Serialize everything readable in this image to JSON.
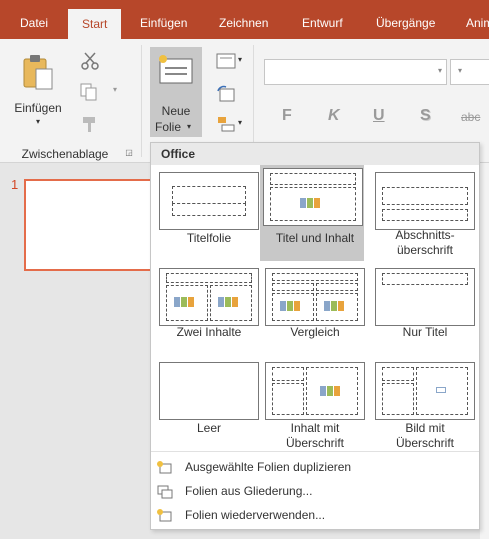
{
  "tabs": [
    {
      "label": "Datei"
    },
    {
      "label": "Start"
    },
    {
      "label": "Einfügen"
    },
    {
      "label": "Zeichnen"
    },
    {
      "label": "Entwurf"
    },
    {
      "label": "Übergänge"
    },
    {
      "label": "Anim"
    }
  ],
  "clipboard": {
    "paste_label": "Einfügen",
    "group_label": "Zwischenablage"
  },
  "new_slide": {
    "line1": "Neue",
    "line2": "Folie"
  },
  "font_format": {
    "bold": "F",
    "italic": "K",
    "underline": "U",
    "shadow": "S",
    "strike": "abc"
  },
  "slide_pane": {
    "slide_number": "1"
  },
  "layout_gallery": {
    "header": "Office",
    "layouts": [
      {
        "name": "Titelfolie"
      },
      {
        "name": "Titel und Inhalt"
      },
      {
        "name": "Abschnitts-",
        "name2": "überschrift"
      },
      {
        "name": "Zwei Inhalte"
      },
      {
        "name": "Vergleich"
      },
      {
        "name": "Nur Titel"
      },
      {
        "name": "Leer"
      },
      {
        "name": "Inhalt mit",
        "name2": "Überschrift"
      },
      {
        "name": "Bild mit",
        "name2": "Überschrift"
      }
    ],
    "selected_layout": "Titel und Inhalt"
  },
  "menu": {
    "items": [
      {
        "label": "Ausgewählte Folien duplizieren"
      },
      {
        "label": "Folien aus Gliederung..."
      },
      {
        "label": "Folien wiederverwenden..."
      }
    ]
  },
  "colors": {
    "accent": "#b7472a",
    "slide_border": "#e46c4a"
  }
}
